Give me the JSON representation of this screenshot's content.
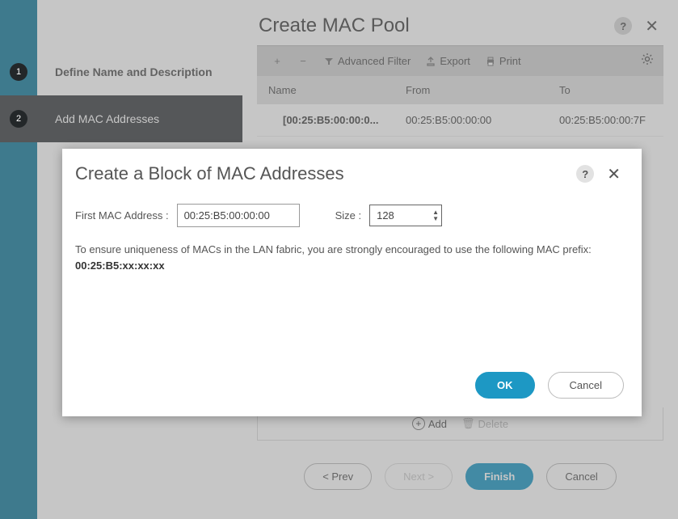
{
  "wizard": {
    "title": "Create MAC Pool",
    "steps": [
      {
        "num": "1",
        "label": "Define Name and Description"
      },
      {
        "num": "2",
        "label": "Add MAC Addresses"
      }
    ],
    "toolbar": {
      "advanced_filter": "Advanced Filter",
      "export": "Export",
      "print": "Print"
    },
    "table": {
      "head_name": "Name",
      "head_from": "From",
      "head_to": "To",
      "rows": [
        {
          "name": "[00:25:B5:00:00:0...",
          "from": "00:25:B5:00:00:00",
          "to": "00:25:B5:00:00:7F"
        }
      ]
    },
    "actions": {
      "add": "Add",
      "delete": "Delete"
    },
    "footer": {
      "prev": "< Prev",
      "next": "Next >",
      "finish": "Finish",
      "cancel": "Cancel"
    }
  },
  "modal": {
    "title": "Create a Block of MAC Addresses",
    "first_mac_label": "First MAC Address :",
    "first_mac_value": "00:25:B5:00:00:00",
    "size_label": "Size :",
    "size_value": "128",
    "info_text": "To ensure uniqueness of MACs in the LAN fabric, you are strongly encouraged to use the following MAC prefix:",
    "info_prefix": "00:25:B5:xx:xx:xx",
    "ok": "OK",
    "cancel": "Cancel"
  }
}
